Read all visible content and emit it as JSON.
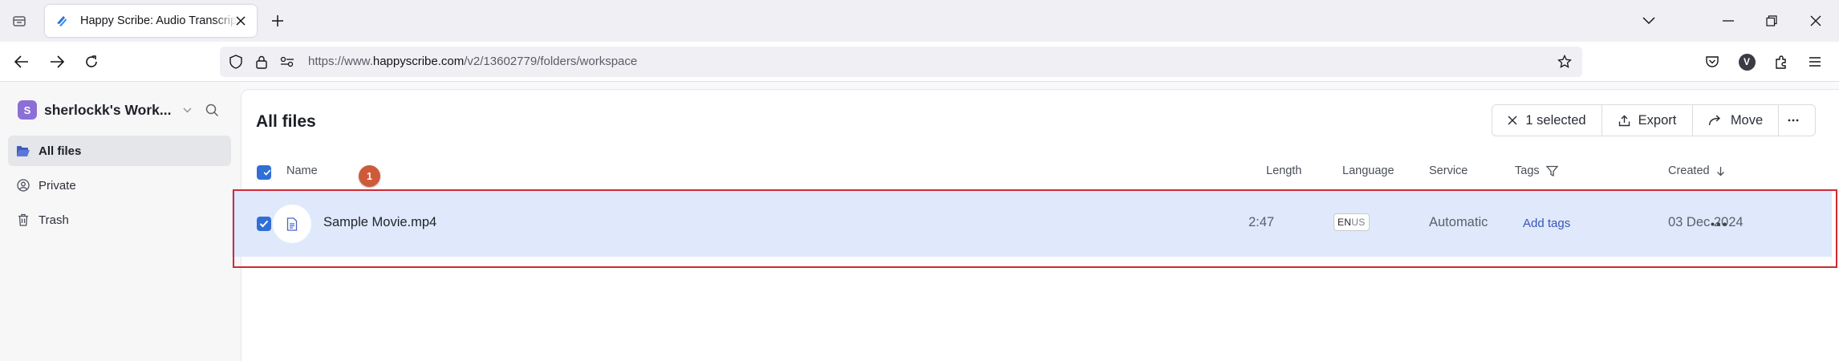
{
  "browser": {
    "tab": {
      "title": "Happy Scribe: Audio Transcripti"
    },
    "url": {
      "prefix": "https://www.",
      "host": "happyscribe.com",
      "path": "/v2/13602779/folders/workspace"
    },
    "extension_avatar": "V"
  },
  "sidebar": {
    "workspace": {
      "avatar": "S",
      "name": "sherlockk's Work..."
    },
    "items": [
      {
        "label": "All files",
        "active": true
      },
      {
        "label": "Private",
        "active": false
      },
      {
        "label": "Trash",
        "active": false
      }
    ]
  },
  "main": {
    "title": "All files",
    "toolbar": {
      "selected_label": "1 selected",
      "export_label": "Export",
      "move_label": "Move"
    },
    "columns": {
      "name": "Name",
      "length": "Length",
      "language": "Language",
      "service": "Service",
      "tags": "Tags",
      "created": "Created"
    },
    "step_marker": "1",
    "rows": [
      {
        "name": "Sample Movie.mp4",
        "length": "2:47",
        "language_code": "EN",
        "language_region": "US",
        "service": "Automatic",
        "tags_action": "Add tags",
        "created": "03 Dec 2024",
        "selected": true
      }
    ]
  },
  "colors": {
    "accent": "#2f6fd6",
    "row_selected": "#dfe9fb",
    "highlight_border": "#cc2b36",
    "step_marker": "#cf5a3a",
    "workspace_avatar": "#8b6fd6"
  }
}
